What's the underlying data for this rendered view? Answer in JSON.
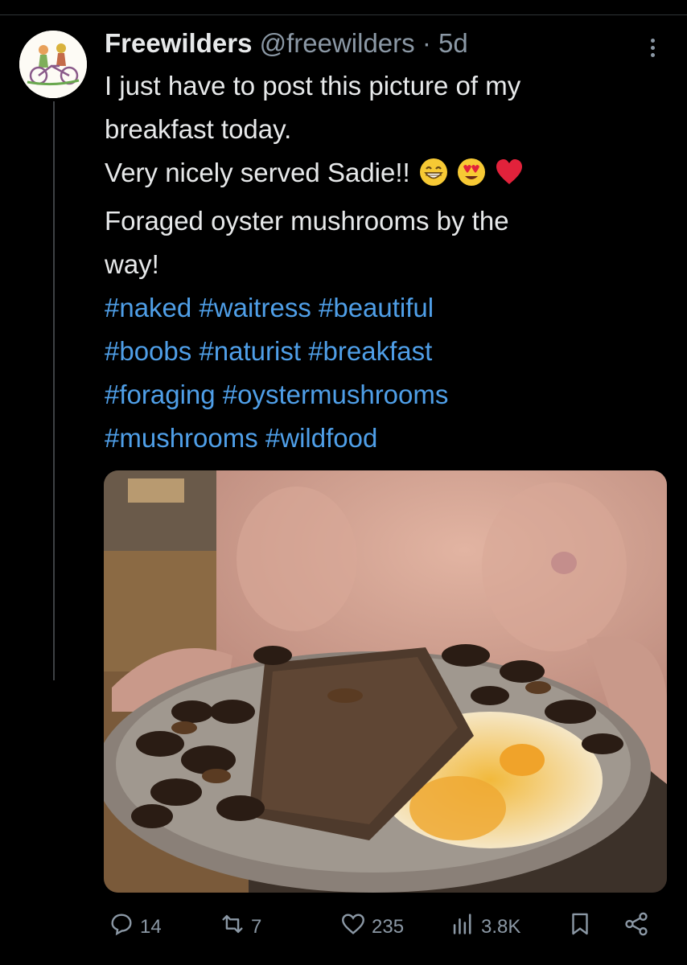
{
  "post": {
    "author_name": "Freewilders",
    "handle": "@freewilders",
    "separator": "·",
    "age": "5d",
    "text_lines": [
      "I just have to post this picture of my",
      "breakfast today.",
      "Very nicely served Sadie!!",
      "Foraged oyster mushrooms by the",
      "way!"
    ],
    "emojis": [
      "grinning-face-with-smiling-eyes",
      "smiling-face-with-heart-eyes",
      "red-heart"
    ],
    "hashtag_lines": [
      [
        "#naked",
        "#waitress",
        "#beautiful"
      ],
      [
        "#boobs",
        "#naturist",
        "#breakfast"
      ],
      [
        "#foraging",
        "#oystermushrooms"
      ],
      [
        "#mushrooms",
        "#wildfood"
      ]
    ]
  },
  "actions": {
    "replies": "14",
    "reposts": "7",
    "likes": "235",
    "views": "3.8K"
  },
  "icons": {
    "reply": "speech-bubble-icon",
    "repost": "repost-arrows-icon",
    "like": "heart-icon",
    "views": "bar-chart-icon",
    "bookmark": "bookmark-icon",
    "share": "share-icon",
    "more": "more-vertical-icon"
  },
  "colors": {
    "background": "#000000",
    "text": "#e7e9ea",
    "secondary_text": "#8b98a5",
    "hashtag": "#4f9fe8"
  }
}
